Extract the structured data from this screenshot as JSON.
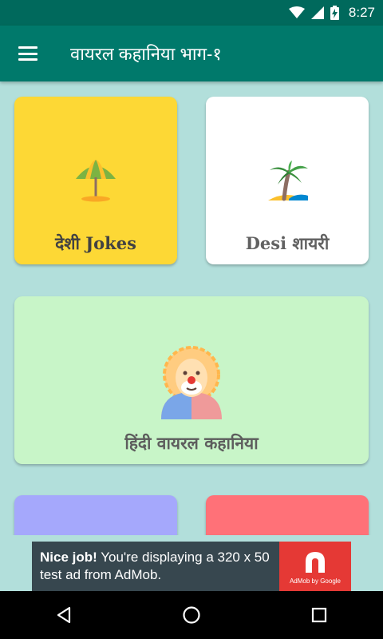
{
  "status_bar": {
    "time": "8:27"
  },
  "app_bar": {
    "title": "वायरल कहानिया भाग-१",
    "menu_icon": "hamburger-menu-icon"
  },
  "cards": [
    {
      "label": "देशी Jokes",
      "icon": "beach-umbrella-icon",
      "color": "#fdd835"
    },
    {
      "label": "Desi शायरी",
      "icon": "palm-tree-icon",
      "color": "#ffffff"
    },
    {
      "label": "हिंदी वायरल कहानिया",
      "icon": "clown-icon",
      "color": "#c8f5c8"
    },
    {
      "label": "",
      "color": "#a5a8fc"
    },
    {
      "label": "",
      "color": "#ff7178"
    }
  ],
  "ad": {
    "headline": "Nice job!",
    "body": "You're displaying a 320 x 50 test ad from AdMob.",
    "brand": "AdMob by Google"
  },
  "colors": {
    "primary_dark": "#00695c",
    "primary": "#00796b",
    "background": "#b2dfdb"
  }
}
